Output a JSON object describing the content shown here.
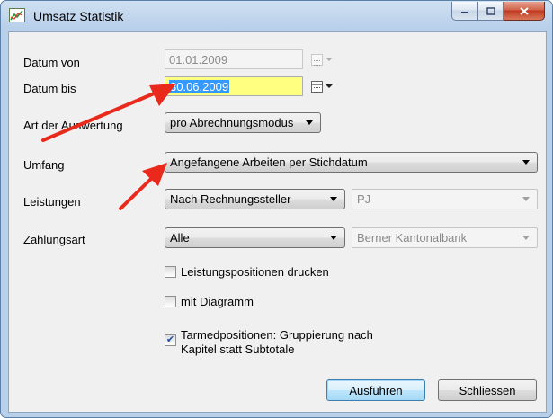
{
  "window": {
    "title": "Umsatz Statistik",
    "icon": "chart-icon"
  },
  "form": {
    "datum_von": {
      "label": "Datum von",
      "value": "01.01.2009"
    },
    "datum_bis": {
      "label": "Datum bis",
      "value": "30.06.2009"
    },
    "art_der_auswertung": {
      "label": "Art der Auswertung",
      "value": "pro Abrechnungsmodus"
    },
    "umfang": {
      "label": "Umfang",
      "value": "Angefangene Arbeiten per Stichdatum"
    },
    "leistungen": {
      "label": "Leistungen",
      "value": "Nach Rechnungssteller",
      "secondary_value": "PJ"
    },
    "zahlungsart": {
      "label": "Zahlungsart",
      "value": "Alle",
      "secondary_value": "Berner Kantonalbank"
    }
  },
  "checkboxes": {
    "leistungspositionen": {
      "label": "Leistungspositionen drucken",
      "checked": false
    },
    "diagramm": {
      "label": "mit Diagramm",
      "checked": false
    },
    "tarmed": {
      "label_line1": "Tarmedpositionen: Gruppierung nach",
      "label_line2": "Kapitel statt Subtotale",
      "checked": true
    }
  },
  "buttons": {
    "ausfuehren": {
      "accel": "A",
      "rest": "usführen"
    },
    "schliessen": {
      "pre": "Sch",
      "accel": "l",
      "rest": "iessen"
    }
  },
  "colors": {
    "annotation_arrow": "#e8291c",
    "selection": "#3399ff",
    "field_highlight": "#ffff80"
  }
}
